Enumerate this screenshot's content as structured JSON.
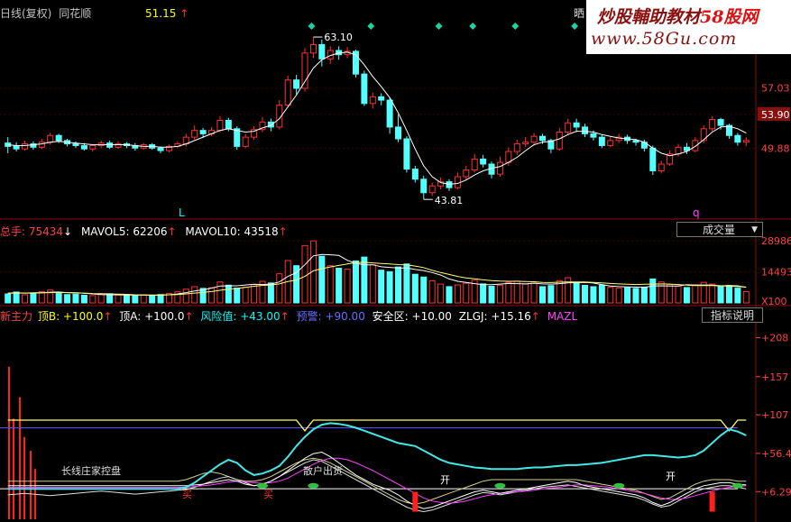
{
  "price_header": {
    "title": "日线(复权)",
    "stock": "同花顺",
    "value": "51.15",
    "arrow": "↑",
    "right_label": "晒"
  },
  "watermark": {
    "line1_a": "炒股輔助教材",
    "line1_b": "58股网",
    "line2": "www.58Gu.com"
  },
  "price_axis": [
    "57.03",
    "53.90",
    "49.88"
  ],
  "price_markers": {
    "high": "63.10",
    "low": "43.81",
    "left_letter": "L",
    "right_letter": "q"
  },
  "volume_header": {
    "items": [
      {
        "label": "总手: 75434",
        "arrow": "↓",
        "color": "#ff4040"
      },
      {
        "label": "MAVOL5: 62206",
        "arrow": "↑",
        "color": "#ffffff"
      },
      {
        "label": "MAVOL10: 43518",
        "arrow": "↑",
        "color": "#ffffff"
      }
    ],
    "dropdown": "成交量",
    "dropdown_arrow": "▼"
  },
  "volume_axis": [
    "28986",
    "14493",
    "X100"
  ],
  "indicator_header": {
    "items": [
      {
        "label": "新主力",
        "color": "#ff4040"
      },
      {
        "label": "顶B: +100.0",
        "arrow": "↑",
        "color": "#ffff00"
      },
      {
        "label": "顶A: +100.0",
        "arrow": "↑",
        "color": "#ffffff"
      },
      {
        "label": "风险值: +43.00",
        "arrow": "↑",
        "color": "#00ffff"
      },
      {
        "label": "预警: +90.00",
        "color": "#6060ff"
      },
      {
        "label": "安全区: +10.00",
        "color": "#ffffff"
      },
      {
        "label": "ZLGJ: +15.16",
        "arrow": "↑",
        "color": "#ffffff"
      },
      {
        "label": "MAZL",
        "color": "#ff40ff"
      }
    ],
    "button": "指标说明"
  },
  "indicator_axis": [
    "+208",
    "+157",
    "+107",
    "+56.4",
    "+6.29"
  ],
  "indicator_labels": {
    "in_chart_1": "长线庄家控盘",
    "in_chart_2": "散户出货",
    "buy": "买",
    "sell": "卖",
    "flat": "开"
  },
  "chart_data": {
    "type": "candlestick",
    "price_range": [
      42.0,
      64.5
    ],
    "candles": [
      [
        50.5,
        50.1,
        51.2,
        49.3
      ],
      [
        50.2,
        49.8,
        50.6,
        49.5
      ],
      [
        49.8,
        50.4,
        50.8,
        49.6
      ],
      [
        50.4,
        50.0,
        50.7,
        49.7
      ],
      [
        50.0,
        50.6,
        51.0,
        49.8
      ],
      [
        50.6,
        51.4,
        51.7,
        50.3
      ],
      [
        51.4,
        50.8,
        51.6,
        50.5
      ],
      [
        50.8,
        50.4,
        51.0,
        50.1
      ],
      [
        50.4,
        50.2,
        50.7,
        49.9
      ],
      [
        50.2,
        49.8,
        50.5,
        49.6
      ],
      [
        49.8,
        50.2,
        50.4,
        49.5
      ],
      [
        50.2,
        50.5,
        50.8,
        49.9
      ],
      [
        50.5,
        50.0,
        50.8,
        49.8
      ],
      [
        50.0,
        50.4,
        50.7,
        49.8
      ],
      [
        50.4,
        50.2,
        50.6,
        49.9
      ],
      [
        50.2,
        49.9,
        50.5,
        49.6
      ],
      [
        49.9,
        50.3,
        50.5,
        49.7
      ],
      [
        50.3,
        49.9,
        50.5,
        49.7
      ],
      [
        49.9,
        49.6,
        50.1,
        49.3
      ],
      [
        49.6,
        50.1,
        50.3,
        49.4
      ],
      [
        50.1,
        50.4,
        50.7,
        49.9
      ],
      [
        50.4,
        51.2,
        51.6,
        50.1
      ],
      [
        51.2,
        52.0,
        52.6,
        50.9
      ],
      [
        52.0,
        51.6,
        52.3,
        51.1
      ],
      [
        51.6,
        52.0,
        52.4,
        51.3
      ],
      [
        52.0,
        53.2,
        53.7,
        51.8
      ],
      [
        53.2,
        52.2,
        53.5,
        51.9
      ],
      [
        52.2,
        50.1,
        52.5,
        49.7
      ],
      [
        50.1,
        51.2,
        51.6,
        49.9
      ],
      [
        51.2,
        52.1,
        52.5,
        50.9
      ],
      [
        52.1,
        53.0,
        53.6,
        51.8
      ],
      [
        53.0,
        52.4,
        53.4,
        51.9
      ],
      [
        52.4,
        55.0,
        55.6,
        52.1
      ],
      [
        55.0,
        58.0,
        58.5,
        54.7
      ],
      [
        58.0,
        57.0,
        58.6,
        56.3
      ],
      [
        57.0,
        61.2,
        61.8,
        56.6
      ],
      [
        61.2,
        62.2,
        63.1,
        60.6
      ],
      [
        62.2,
        60.5,
        62.8,
        59.6
      ],
      [
        60.5,
        61.5,
        62.0,
        59.9
      ],
      [
        61.5,
        61.0,
        62.0,
        60.4
      ],
      [
        61.0,
        61.4,
        61.9,
        60.6
      ],
      [
        61.4,
        58.7,
        61.6,
        58.3
      ],
      [
        58.7,
        55.2,
        59.1,
        54.9
      ],
      [
        55.2,
        56.0,
        56.5,
        54.6
      ],
      [
        56.0,
        55.6,
        56.4,
        55.0
      ],
      [
        55.6,
        52.4,
        55.9,
        51.6
      ],
      [
        52.4,
        51.0,
        53.9,
        50.6
      ],
      [
        51.0,
        47.4,
        51.3,
        47.0
      ],
      [
        47.4,
        46.2,
        47.8,
        45.8
      ],
      [
        46.2,
        44.6,
        46.6,
        43.8
      ],
      [
        44.6,
        45.4,
        45.8,
        44.2
      ],
      [
        45.4,
        45.9,
        46.4,
        45.0
      ],
      [
        45.9,
        45.2,
        46.2,
        44.8
      ],
      [
        45.2,
        46.5,
        47.0,
        45.0
      ],
      [
        46.5,
        47.3,
        47.8,
        46.1
      ],
      [
        47.3,
        48.6,
        49.2,
        47.0
      ],
      [
        48.6,
        48.0,
        49.1,
        47.6
      ],
      [
        48.0,
        46.8,
        48.3,
        46.3
      ],
      [
        46.8,
        48.2,
        48.9,
        46.5
      ],
      [
        48.2,
        49.5,
        50.0,
        47.8
      ],
      [
        49.5,
        50.4,
        50.9,
        49.1
      ],
      [
        50.4,
        50.6,
        51.2,
        50.0
      ],
      [
        50.6,
        51.3,
        51.7,
        50.2
      ],
      [
        51.3,
        50.8,
        51.6,
        50.4
      ],
      [
        50.8,
        49.8,
        51.0,
        49.3
      ],
      [
        49.8,
        51.8,
        52.3,
        49.6
      ],
      [
        51.8,
        52.9,
        53.4,
        51.5
      ],
      [
        52.9,
        52.4,
        53.4,
        51.8
      ],
      [
        52.4,
        51.6,
        52.8,
        51.2
      ],
      [
        51.6,
        51.2,
        52.0,
        50.8
      ],
      [
        51.2,
        50.2,
        51.5,
        49.9
      ],
      [
        50.2,
        50.8,
        51.2,
        50.0
      ],
      [
        50.8,
        51.2,
        51.6,
        50.5
      ],
      [
        51.2,
        50.8,
        51.5,
        50.4
      ],
      [
        50.8,
        50.6,
        51.0,
        50.2
      ],
      [
        50.6,
        49.9,
        50.9,
        49.5
      ],
      [
        49.9,
        47.2,
        50.2,
        46.7
      ],
      [
        47.2,
        48.0,
        48.4,
        46.9
      ],
      [
        48.0,
        49.2,
        49.6,
        47.8
      ],
      [
        49.2,
        50.0,
        50.4,
        48.9
      ],
      [
        50.0,
        49.6,
        50.5,
        49.2
      ],
      [
        49.6,
        50.8,
        51.2,
        49.4
      ],
      [
        50.8,
        52.2,
        52.6,
        50.5
      ],
      [
        52.2,
        53.3,
        53.7,
        51.9
      ],
      [
        53.3,
        52.6,
        53.5,
        52.1
      ],
      [
        52.6,
        51.4,
        52.8,
        51.0
      ],
      [
        51.4,
        50.6,
        51.7,
        50.2
      ],
      [
        50.6,
        50.8,
        51.2,
        50.1
      ]
    ],
    "ma_line": [
      50.3,
      50.2,
      50.2,
      50.3,
      50.4,
      50.6,
      50.7,
      50.6,
      50.5,
      50.4,
      50.3,
      50.3,
      50.3,
      50.3,
      50.3,
      50.2,
      50.1,
      50.1,
      50.0,
      50.0,
      50.1,
      50.4,
      50.8,
      51.2,
      51.6,
      52.0,
      52.2,
      52.0,
      51.8,
      51.9,
      52.3,
      52.6,
      53.4,
      54.8,
      56.2,
      57.8,
      59.4,
      60.4,
      60.9,
      61.2,
      61.3,
      61.0,
      59.8,
      58.4,
      57.2,
      55.9,
      54.1,
      52.0,
      49.8,
      47.8,
      46.5,
      45.8,
      45.6,
      45.7,
      46.1,
      46.7,
      47.2,
      47.5,
      47.7,
      48.2,
      48.8,
      49.6,
      50.3,
      50.6,
      50.7,
      51.0,
      51.5,
      51.9,
      51.9,
      51.8,
      51.5,
      51.3,
      51.1,
      51.0,
      50.9,
      50.6,
      49.9,
      49.3,
      49.0,
      49.2,
      49.5,
      50.1,
      50.9,
      51.8,
      52.4,
      52.5,
      52.2,
      51.7
    ],
    "volume_range": [
      0,
      32000
    ],
    "volumes": [
      4200,
      5100,
      3800,
      4600,
      5300,
      6000,
      4700,
      3900,
      4100,
      3600,
      3400,
      3900,
      4300,
      3700,
      3500,
      3600,
      3800,
      3300,
      3900,
      4400,
      5200,
      6400,
      7600,
      6800,
      7100,
      9800,
      8300,
      6900,
      7300,
      8600,
      10100,
      9300,
      13600,
      19800,
      17400,
      26800,
      28986,
      21800,
      17400,
      16200,
      15800,
      19600,
      21400,
      17800,
      15300,
      14600,
      16800,
      18200,
      13400,
      12100,
      10300,
      8800,
      7600,
      8400,
      9200,
      10600,
      8900,
      7800,
      8300,
      9600,
      10200,
      8800,
      9300,
      7600,
      8100,
      10400,
      11800,
      9300,
      8200,
      7600,
      8300,
      7300,
      6900,
      7100,
      6800,
      7400,
      11200,
      9800,
      8600,
      7900,
      7200,
      8400,
      9600,
      8800,
      7700,
      8100,
      6900,
      5300
    ],
    "mavol5": [
      4600,
      4700,
      4600,
      4700,
      4700,
      5000,
      5100,
      4800,
      4700,
      4500,
      4200,
      3900,
      3800,
      3800,
      3700,
      3700,
      3700,
      3600,
      3600,
      3800,
      4200,
      4800,
      5600,
      6100,
      6900,
      7900,
      8000,
      8000,
      8400,
      8700,
      8600,
      8800,
      9800,
      12400,
      14100,
      17800,
      22000,
      22600,
      22500,
      22200,
      19900,
      18500,
      17800,
      17800,
      16900,
      16600,
      16300,
      16300,
      15600,
      15100,
      14200,
      13000,
      11200,
      10100,
      9600,
      9000,
      8500,
      8500,
      8800,
      9100,
      9000,
      8900,
      9200,
      8900,
      8800,
      9000,
      9400,
      9500,
      9600,
      9300,
      8600,
      7900,
      7600,
      7500,
      7400,
      7300,
      7900,
      8000,
      7900,
      7900,
      8500,
      8400,
      8400,
      8300,
      8000,
      8100,
      8000,
      7300
    ],
    "mavol10": [
      4500,
      4600,
      4600,
      4600,
      4700,
      4800,
      4900,
      4800,
      4700,
      4600,
      4400,
      4300,
      4200,
      4100,
      4000,
      3800,
      3700,
      3700,
      3700,
      3800,
      3900,
      4200,
      4600,
      4900,
      5300,
      5900,
      6400,
      6800,
      7300,
      7800,
      8200,
      8400,
      8900,
      10000,
      10700,
      12400,
      15000,
      16000,
      16800,
      17500,
      18200,
      18800,
      19000,
      18700,
      18400,
      18200,
      17900,
      17800,
      17200,
      16500,
      15200,
      14200,
      13300,
      12400,
      11700,
      11300,
      10800,
      10400,
      10200,
      10100,
      10100,
      10000,
      9900,
      9600,
      9500,
      9700,
      9800,
      9800,
      9800,
      9600,
      9400,
      9100,
      8900,
      8700,
      8600,
      8700,
      8800,
      8900,
      8800,
      8600,
      8300,
      8100,
      8100,
      8100,
      8000,
      7800,
      7600,
      7400
    ],
    "indicator_range": [
      -30,
      230
    ],
    "ref_levels": {
      "dingB": 100,
      "warning": 90,
      "safe": 10
    },
    "risk": [
      10,
      10,
      10,
      10,
      10,
      10,
      10,
      10,
      10,
      10,
      10,
      10,
      10,
      10,
      10,
      10,
      10,
      10,
      10,
      10,
      10,
      12,
      18,
      26,
      34,
      42,
      48,
      44,
      34,
      28,
      30,
      34,
      40,
      52,
      66,
      78,
      88,
      94,
      96,
      95,
      93,
      90,
      86,
      82,
      78,
      74,
      70,
      68,
      66,
      60,
      54,
      48,
      44,
      42,
      40,
      38,
      37,
      36,
      36,
      36,
      36,
      37,
      38,
      38,
      39,
      40,
      41,
      41,
      42,
      43,
      44,
      46,
      48,
      50,
      52,
      54,
      54,
      53,
      52,
      51,
      52,
      54,
      60,
      70,
      80,
      88,
      85,
      80
    ],
    "dingA": [
      100,
      100,
      100,
      100,
      100,
      100,
      100,
      100,
      100,
      100,
      100,
      100,
      100,
      100,
      100,
      100,
      100,
      100,
      100,
      100,
      100,
      100,
      100,
      100,
      100,
      100,
      100,
      100,
      100,
      100,
      100,
      100,
      100,
      100,
      100,
      86,
      100,
      100,
      100,
      100,
      100,
      100,
      100,
      100,
      100,
      100,
      100,
      100,
      100,
      100,
      100,
      100,
      100,
      100,
      100,
      100,
      100,
      100,
      100,
      100,
      100,
      100,
      100,
      100,
      100,
      100,
      100,
      100,
      100,
      100,
      100,
      100,
      100,
      100,
      100,
      100,
      100,
      100,
      100,
      100,
      100,
      100,
      100,
      100,
      100,
      86,
      100,
      100
    ],
    "zlgj": [
      14,
      14,
      14,
      14,
      14,
      14,
      14,
      14,
      14,
      14,
      14,
      14,
      14,
      14,
      14,
      14,
      14,
      14,
      14,
      14,
      14,
      14,
      15,
      16,
      18,
      20,
      22,
      20,
      16,
      14,
      16,
      20,
      26,
      34,
      42,
      50,
      56,
      58,
      52,
      44,
      36,
      28,
      22,
      16,
      12,
      8,
      2,
      -6,
      -12,
      -16,
      -14,
      -10,
      -6,
      -2,
      2,
      6,
      8,
      6,
      4,
      6,
      8,
      10,
      12,
      14,
      16,
      18,
      20,
      18,
      14,
      12,
      10,
      8,
      6,
      4,
      2,
      -2,
      -8,
      -12,
      -8,
      -2,
      4,
      10,
      14,
      16,
      18,
      18,
      16,
      15
    ],
    "mazl": [
      12,
      12,
      12,
      12,
      12,
      12,
      12,
      12,
      12,
      12,
      12,
      12,
      12,
      12,
      12,
      12,
      12,
      12,
      12,
      12,
      12,
      12,
      13,
      14,
      15,
      17,
      19,
      20,
      19,
      18,
      17,
      18,
      20,
      24,
      30,
      36,
      42,
      47,
      50,
      50,
      48,
      44,
      39,
      34,
      28,
      22,
      16,
      10,
      4,
      -2,
      -6,
      -8,
      -9,
      -8,
      -6,
      -3,
      0,
      2,
      4,
      5,
      6,
      7,
      8,
      10,
      11,
      12,
      14,
      15,
      15,
      14,
      13,
      12,
      10,
      8,
      6,
      4,
      1,
      -2,
      -4,
      -4,
      -2,
      1,
      4,
      7,
      10,
      12,
      13,
      14
    ],
    "extra_lines": [
      [
        2,
        3,
        4,
        3,
        2,
        1,
        2,
        3,
        4,
        5,
        6,
        7,
        6,
        5,
        4,
        3,
        4,
        5,
        6,
        7,
        8,
        9,
        12,
        16,
        20,
        24,
        26,
        22,
        18,
        14,
        16,
        20,
        26,
        32,
        38,
        44,
        48,
        46,
        40,
        34,
        28,
        22,
        16,
        10,
        4,
        -2,
        -8,
        -14,
        -18,
        -20,
        -18,
        -14,
        -10,
        -6,
        -2,
        2,
        5,
        4,
        2,
        4,
        6,
        8,
        10,
        12,
        13,
        14,
        15,
        13,
        11,
        9,
        7,
        5,
        3,
        1,
        -1,
        -5,
        -10,
        -14,
        -12,
        -6,
        0,
        6,
        10,
        12,
        14,
        14,
        12,
        10
      ],
      [
        20,
        20,
        20,
        20,
        20,
        20,
        20,
        20,
        20,
        20,
        20,
        20,
        20,
        20,
        20,
        20,
        20,
        20,
        20,
        20,
        20,
        22,
        26,
        30,
        32,
        30,
        26,
        22,
        20,
        20,
        22,
        26,
        32,
        38,
        44,
        48,
        50,
        48,
        44,
        38,
        32,
        26,
        20,
        14,
        8,
        2,
        -4,
        -8,
        -10,
        -8,
        -4,
        0,
        4,
        8,
        12,
        16,
        20,
        22,
        22,
        22,
        22,
        22,
        22,
        22,
        22,
        22,
        22,
        22,
        20,
        18,
        16,
        14,
        12,
        10,
        8,
        4,
        0,
        -4,
        -2,
        4,
        10,
        16,
        20,
        22,
        22,
        22,
        20,
        20
      ]
    ],
    "volume_spikes_left": [
      170,
      130,
      60
    ]
  }
}
